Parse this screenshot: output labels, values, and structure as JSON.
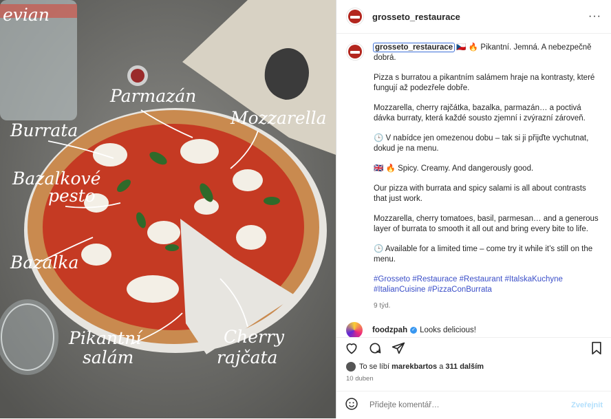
{
  "post": {
    "photo_labels": {
      "bottle": "evian",
      "burrata": "Burrata",
      "parmazan": "Parmazán",
      "mozzarella": "Mozzarella",
      "pesto_1": "Bazalkové",
      "pesto_2": "pesto",
      "bazalka": "Bazalka",
      "salam_1": "Pikantní",
      "salam_2": "salám",
      "cherry_1": "Cherry",
      "cherry_2": "rajčata"
    }
  },
  "header": {
    "username": "grosseto_restaurace",
    "more": "···"
  },
  "caption": {
    "username": "grosseto_restaurace",
    "flag_cz": "🇨🇿",
    "fire": "🔥",
    "line1": "Pikantní. Jemná. A nebezpečně dobrá.",
    "p2": "Pizza s burratou a pikantním salámem hraje na kontrasty, které fungují až podezřele dobře.",
    "p3": "Mozzarella, cherry rajčátka, bazalka, parmazán… a poctivá dávka burraty, která každé sousto zjemní i zvýrazní zároveň.",
    "clock": "🕒",
    "p4": "V nabídce jen omezenou dobu – tak si ji přijďte vychutnat, dokud je na menu.",
    "flag_uk": "🇬🇧",
    "p5": "Spicy. Creamy. And dangerously good.",
    "p6": "Our pizza with burrata and spicy salami is all about contrasts that just work.",
    "p7": "Mozzarella, cherry tomatoes, basil, parmesan… and a generous layer of burrata to smooth it all out and bring every bite to life.",
    "p8": "Available for a limited time – come try it while it’s still on the menu.",
    "hashtags": "#Grosseto #Restaurace #Restaurant #ItalskaKuchyne #ItalianCuisine #PizzaConBurrata",
    "age": "9 týd."
  },
  "comment": {
    "username": "foodzpah",
    "verified": "✓",
    "text": "Looks delicious!"
  },
  "likes": {
    "prefix": "To se líbí",
    "user": "marekbartos",
    "joiner": "a",
    "count": "311 dalším"
  },
  "date": "10 duben",
  "composer": {
    "placeholder": "Přidejte komentář…",
    "post_label": "Zveřejnit"
  },
  "colors": {
    "accent": "#3897f0",
    "hashtag": "#3a4ec8",
    "brand": "#b3261e"
  }
}
